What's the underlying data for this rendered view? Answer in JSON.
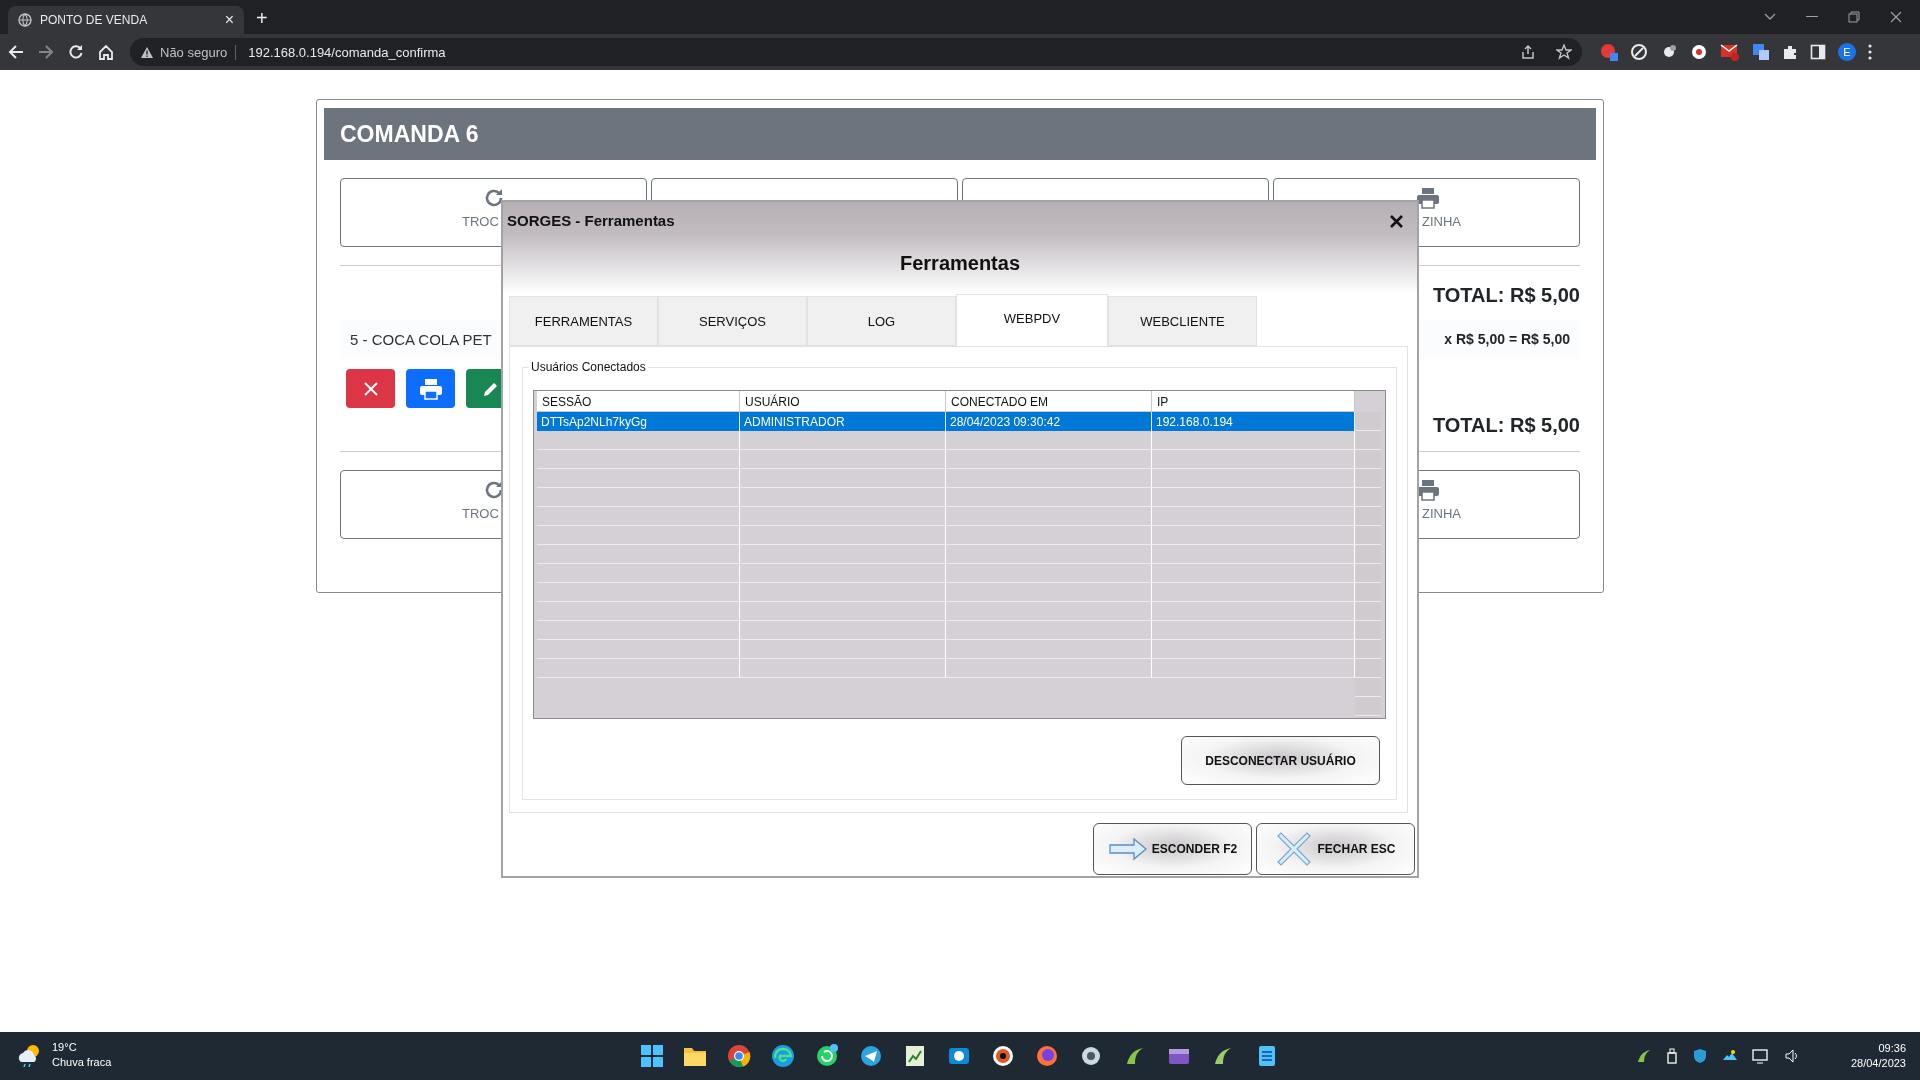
{
  "browser": {
    "tab_title": "PONTO DE VENDA",
    "tab_close": "×",
    "new_tab": "+",
    "security_label": "Não seguro",
    "url": "192.168.0.194/comanda_confirma",
    "profile_initial": "E"
  },
  "page": {
    "title": "COMANDA 6",
    "action_rows": [
      {
        "left_label": "TROC",
        "right_label": "ZINHA"
      },
      {
        "left_label": "TROC",
        "right_label": "ZINHA"
      }
    ],
    "total_top": "TOTAL: R$ 5,00",
    "item": {
      "name": "5 - COCA COLA PET",
      "price_line": "x R$ 5,00 = R$ 5,00"
    },
    "item_buttons": [
      {
        "kind": "delete"
      },
      {
        "kind": "print"
      },
      {
        "kind": "edit"
      }
    ],
    "total_bottom": "TOTAL: R$ 5,00"
  },
  "dialog": {
    "title": "SORGES - Ferramentas",
    "heading": "Ferramentas",
    "tabs": [
      {
        "label": "FERRAMENTAS",
        "selected": false
      },
      {
        "label": "SERVIÇOS",
        "selected": false
      },
      {
        "label": "LOG",
        "selected": false
      },
      {
        "label": "WEBPDV",
        "selected": true
      },
      {
        "label": "WEBCLIENTE",
        "selected": false
      }
    ],
    "group_label": "Usuários Conectados",
    "table": {
      "columns": [
        "SESSÃO",
        "USUÁRIO",
        "CONECTADO EM",
        "IP"
      ],
      "rows": [
        {
          "cells": [
            "DTTsAp2NLh7kyGg",
            "ADMINISTRADOR",
            "28/04/2023 09:30:42",
            "192.168.0.194"
          ],
          "selected": true
        }
      ]
    },
    "disconnect_button": "DESCONECTAR USUÁRIO",
    "footer_buttons": [
      {
        "kind": "hide",
        "label": "ESCONDER F2"
      },
      {
        "kind": "close",
        "label": "FECHAR ESC"
      }
    ]
  },
  "taskbar": {
    "temperature": "19°C",
    "weather": "Chuva fraca",
    "time": "09:36",
    "date": "28/04/2023"
  }
}
